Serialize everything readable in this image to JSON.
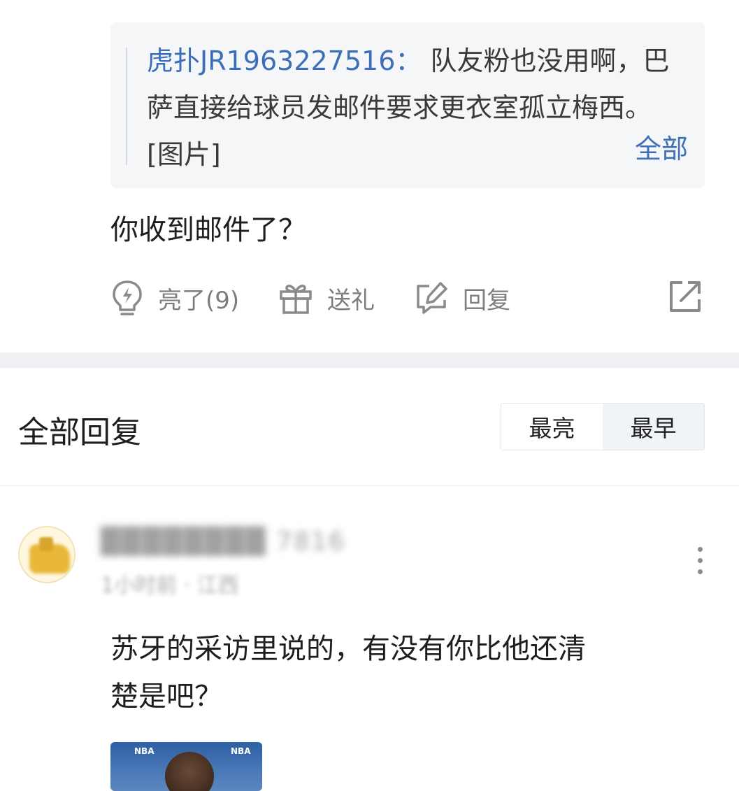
{
  "quoted_reply": {
    "author": "虎扑JR1963227516：",
    "text": " 队友粉也没用啊，巴萨直接给球员发邮件要求更衣室孤立梅西。[图片]",
    "expand_label": "全部"
  },
  "reply": {
    "text": "你收到邮件了？"
  },
  "actions": {
    "like_label": "亮了(9)",
    "gift_label": "送礼",
    "reply_label": "回复"
  },
  "all_replies": {
    "title": "全部回复",
    "sort_options": [
      "最亮",
      "最早"
    ],
    "active_sort": "最早"
  },
  "comment": {
    "username": "████████ 7816",
    "meta": "1小时前 · 江西",
    "text_line1": "苏牙的采访里说的，有没有你比他还清",
    "text_line2": "楚是吧？",
    "image_tags": [
      "NBA",
      "NBA"
    ]
  },
  "colors": {
    "link_blue": "#3d6fb8",
    "quote_bg": "#f5f6f8",
    "active_sort_bg": "#f0f3f8",
    "icon_gray": "#7d7d7d"
  }
}
